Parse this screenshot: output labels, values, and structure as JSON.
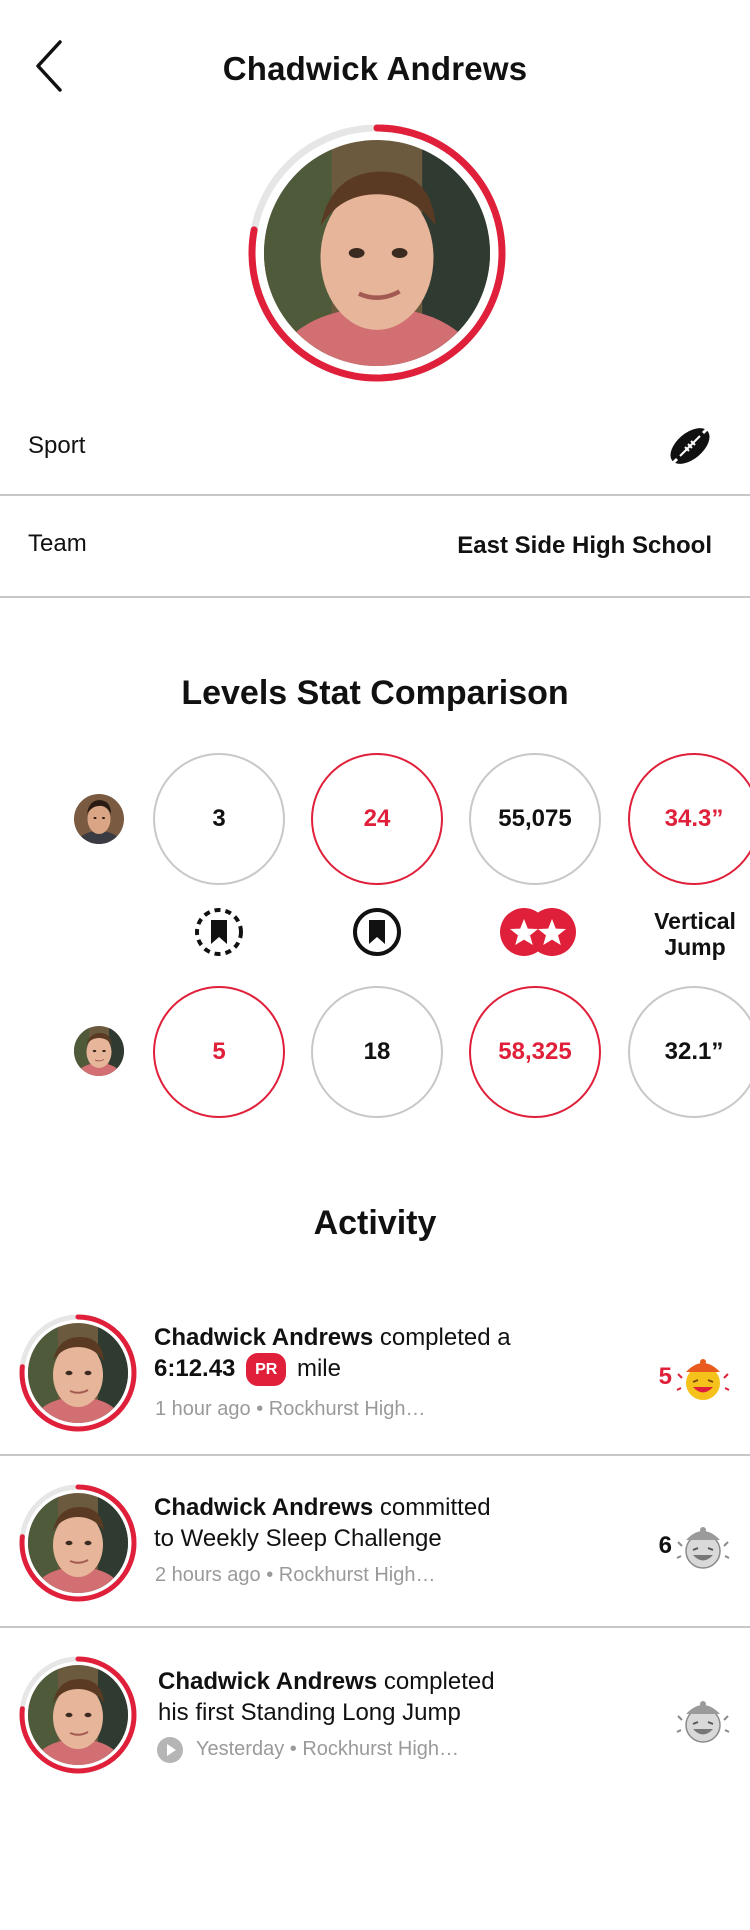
{
  "header": {
    "title": "Chadwick Andrews"
  },
  "profile": {
    "sport_label": "Sport",
    "sport_icon": "football-icon",
    "team_label": "Team",
    "team_value": "East Side High School"
  },
  "levels": {
    "title": "Levels Stat Comparison",
    "top_stats": [
      "3",
      "24",
      "55,075",
      "34.3”"
    ],
    "bottom_stats": [
      "5",
      "18",
      "58,325",
      "32.1”"
    ],
    "stat_icons": [
      "dashed-bookmark-icon",
      "bookmark-icon",
      "double-star-icon"
    ],
    "vertical_jump_label_line1": "Vertical",
    "vertical_jump_label_line2": "Jump",
    "accent": "#e0203a"
  },
  "activity": {
    "title": "Activity",
    "items": [
      {
        "name": "Chadwick Andrews",
        "text_a": " completed a",
        "time_value": "6:12.43",
        "badge": "PR",
        "text_b": " mile",
        "meta": "1 hour ago • Rockhurst High…",
        "count": "5",
        "reaction_icon": "emoji-laugh-icon"
      },
      {
        "name": "Chadwick Andrews",
        "text_a": " committed",
        "text_b": "to Weekly Sleep Challenge",
        "meta": "2 hours ago • Rockhurst High…",
        "count": "6",
        "reaction_icon": "emoji-laugh-gray-icon"
      },
      {
        "name": "Chadwick Andrews",
        "text_a": " completed",
        "text_b": "his first Standing Long Jump",
        "meta": "Yesterday • Rockhurst High…",
        "count": "",
        "reaction_icon": "emoji-laugh-gray-icon"
      }
    ]
  }
}
